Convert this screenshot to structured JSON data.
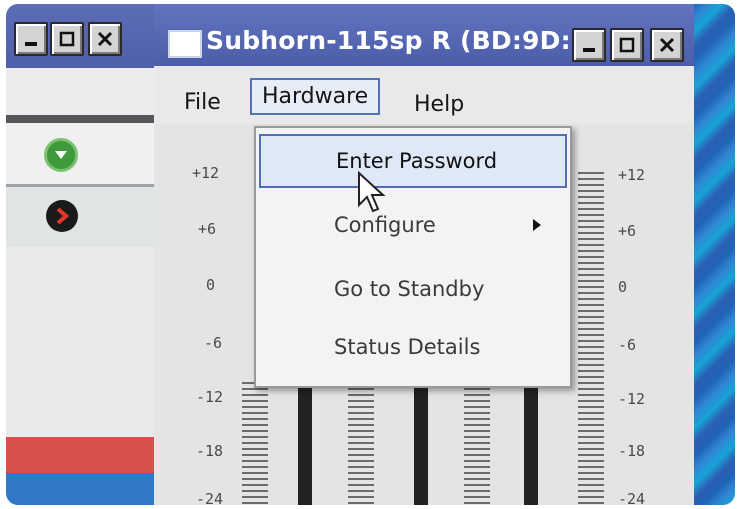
{
  "left_window": {
    "buttons": [
      "minimize",
      "maximize",
      "close"
    ]
  },
  "main_window": {
    "title": "Subhorn-115sp R (BD:9D:...",
    "menu": {
      "file": "File",
      "hardware": "Hardware",
      "help": "Help"
    }
  },
  "hardware_menu": {
    "items": [
      {
        "label": "Enter Password",
        "highlighted": true
      },
      {
        "label": "Configure",
        "has_submenu": true
      },
      {
        "label": "Go to Standby"
      },
      {
        "label": "Status Details"
      }
    ]
  },
  "meter": {
    "left_scale": [
      "+12",
      "+6",
      "0",
      "-6",
      "-12",
      "-18",
      "-24"
    ],
    "right_scale": [
      "+12",
      "+6",
      "0",
      "-6",
      "-12",
      "-18",
      "-24"
    ]
  },
  "icons": {
    "green_button": "play-down-icon",
    "black_button": "next-arrow-icon",
    "cursor": "mouse-pointer-icon"
  },
  "colors": {
    "titlebar": "#5567b3",
    "highlight_border": "#4f70b5",
    "desktop": "#2a6fc0"
  }
}
